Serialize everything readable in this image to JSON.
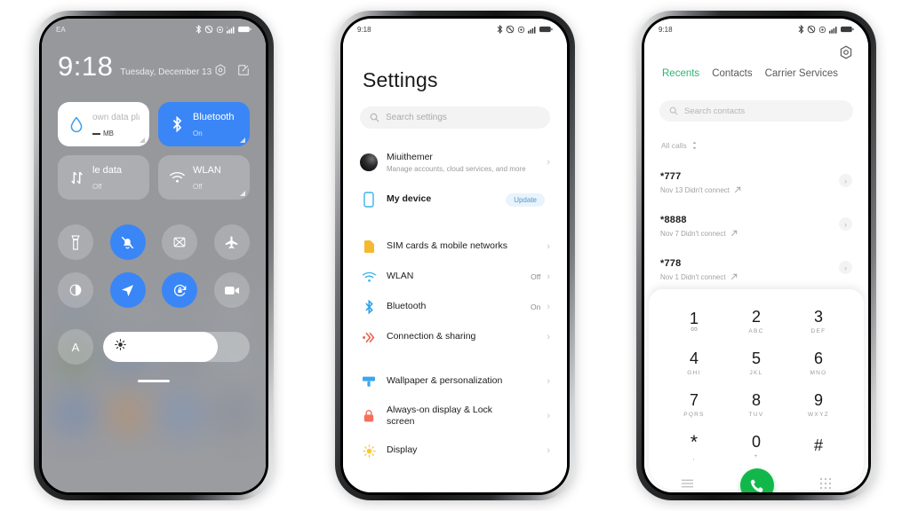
{
  "background_color": "#ffffff",
  "accent": {
    "blue": "#3a86f7",
    "green": "#2bb673",
    "call_green": "#11b74a"
  },
  "phone1": {
    "name": "control-center",
    "statusbar": {
      "carrier": "EA",
      "icons": [
        "bluetooth-icon",
        "dnd-icon",
        "alarm-icon",
        "signal-icon",
        "battery-icon"
      ]
    },
    "clock": {
      "time": "9:18",
      "date": "Tuesday, December 13"
    },
    "header_actions": [
      "settings-hex-icon",
      "edit-icon"
    ],
    "tiles": [
      {
        "name": "data-plan-tile",
        "title": "own data plan",
        "value": "MB",
        "state": "light",
        "icon": "water-drop-icon"
      },
      {
        "name": "bluetooth-tile",
        "title": "Bluetooth",
        "value": "On",
        "state": "on",
        "icon": "bluetooth-icon"
      },
      {
        "name": "mobile-data-tile",
        "title": "le data",
        "value": "Off",
        "state": "off",
        "icon": "data-arrows-icon"
      },
      {
        "name": "wlan-tile",
        "title": "WLAN",
        "value": "Off",
        "state": "off",
        "icon": "wifi-icon"
      }
    ],
    "toggles": [
      {
        "name": "flashlight-toggle",
        "icon": "flashlight-icon",
        "on": false
      },
      {
        "name": "silent-toggle",
        "icon": "bell-mute-icon",
        "on": true
      },
      {
        "name": "screenshot-toggle",
        "icon": "screenshot-icon",
        "on": false
      },
      {
        "name": "airplane-toggle",
        "icon": "airplane-icon",
        "on": false
      },
      {
        "name": "dark-mode-toggle",
        "icon": "contrast-icon",
        "on": false
      },
      {
        "name": "location-toggle",
        "icon": "location-arrow-icon",
        "on": true
      },
      {
        "name": "rotation-lock-toggle",
        "icon": "rotation-lock-icon",
        "on": true
      },
      {
        "name": "screen-record-toggle",
        "icon": "video-camera-icon",
        "on": false
      }
    ],
    "auto_brightness_label": "A",
    "brightness_percent": 78,
    "brightness_icon": "sun-icon"
  },
  "phone2": {
    "name": "settings",
    "statusbar": {
      "time": "9:18",
      "icons": [
        "bluetooth-icon",
        "dnd-icon",
        "alarm-icon",
        "signal-icon",
        "battery-icon"
      ]
    },
    "title": "Settings",
    "search": {
      "placeholder": "Search settings",
      "icon": "search-icon"
    },
    "account": {
      "name": "Miuithemer",
      "subtitle": "Manage accounts, cloud services, and more",
      "icon": "avatar"
    },
    "my_device": {
      "label": "My device",
      "badge": "Update",
      "icon": "phone-outline-icon"
    },
    "groups": [
      [
        {
          "label": "SIM cards & mobile networks",
          "value": "",
          "icon": "sim-card-icon",
          "color": "#f5b82e"
        },
        {
          "label": "WLAN",
          "value": "Off",
          "icon": "wifi-icon",
          "color": "#3ab6e8"
        },
        {
          "label": "Bluetooth",
          "value": "On",
          "icon": "bluetooth-icon",
          "color": "#2fa3e8"
        },
        {
          "label": "Connection & sharing",
          "value": "",
          "icon": "connection-share-icon",
          "color": "#f0604d"
        }
      ],
      [
        {
          "label": "Wallpaper & personalization",
          "value": "",
          "icon": "wallpaper-icon",
          "color": "#3ba7ee"
        },
        {
          "label": "Always-on display & Lock screen",
          "value": "",
          "icon": "lock-icon",
          "color": "#f4705e"
        },
        {
          "label": "Display",
          "value": "",
          "icon": "sun-icon",
          "color": "#fcc63b"
        }
      ]
    ]
  },
  "phone3": {
    "name": "dialer",
    "statusbar": {
      "time": "9:18",
      "icons": [
        "bluetooth-icon",
        "dnd-icon",
        "alarm-icon",
        "signal-icon",
        "battery-icon"
      ]
    },
    "settings_icon": "gear-hex-icon",
    "tabs": [
      {
        "label": "Recents",
        "active": true
      },
      {
        "label": "Contacts",
        "active": false
      },
      {
        "label": "Carrier Services",
        "active": false
      }
    ],
    "search": {
      "placeholder": "Search contacts",
      "icon": "search-icon"
    },
    "filter": {
      "label": "All calls",
      "icon": "sort-icon"
    },
    "calls": [
      {
        "number": "*777",
        "meta": "Nov 13 Didn't connect",
        "direction_icon": "outgoing-arrow-icon"
      },
      {
        "number": "*8888",
        "meta": "Nov 7 Didn't connect",
        "direction_icon": "outgoing-arrow-icon"
      },
      {
        "number": "*778",
        "meta": "Nov 1 Didn't connect",
        "direction_icon": "outgoing-arrow-icon"
      }
    ],
    "keys": [
      {
        "digit": "1",
        "letters": "∞"
      },
      {
        "digit": "2",
        "letters": "ABC"
      },
      {
        "digit": "3",
        "letters": "DEF"
      },
      {
        "digit": "4",
        "letters": "GHI"
      },
      {
        "digit": "5",
        "letters": "JKL"
      },
      {
        "digit": "6",
        "letters": "MNO"
      },
      {
        "digit": "7",
        "letters": "PQRS"
      },
      {
        "digit": "8",
        "letters": "TUV"
      },
      {
        "digit": "9",
        "letters": "WXYZ"
      },
      {
        "digit": "*",
        "letters": ","
      },
      {
        "digit": "0",
        "letters": "+"
      },
      {
        "digit": "#",
        "letters": ""
      }
    ],
    "bottom": {
      "left_icon": "menu-icon",
      "call_icon": "phone-icon",
      "right_icon": "keypad-icon"
    }
  }
}
